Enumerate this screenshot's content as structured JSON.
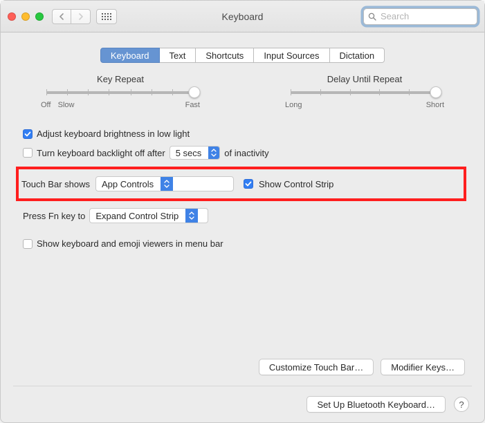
{
  "window": {
    "title": "Keyboard"
  },
  "search": {
    "placeholder": "Search"
  },
  "tabs": [
    {
      "label": "Keyboard",
      "active": true
    },
    {
      "label": "Text"
    },
    {
      "label": "Shortcuts"
    },
    {
      "label": "Input Sources"
    },
    {
      "label": "Dictation"
    }
  ],
  "sliders": {
    "key_repeat": {
      "title": "Key Repeat",
      "left": "Off",
      "left2": "Slow",
      "right": "Fast",
      "pos": 1.0
    },
    "delay_until": {
      "title": "Delay Until Repeat",
      "left": "Long",
      "right": "Short",
      "pos": 0.98
    }
  },
  "checks": {
    "brightness": {
      "label": "Adjust keyboard brightness in low light",
      "checked": true
    },
    "backlight_off": {
      "label": "Turn keyboard backlight off after",
      "checked": false
    },
    "backlight_time": "5 secs",
    "inactivity_suffix": "of inactivity",
    "touchbar_label": "Touch Bar shows",
    "touchbar_value": "App Controls",
    "show_control_strip": {
      "label": "Show Control Strip",
      "checked": true
    },
    "fn_label": "Press Fn key to",
    "fn_value": "Expand Control Strip",
    "show_viewers": {
      "label": "Show keyboard and emoji viewers in menu bar",
      "checked": false
    }
  },
  "buttons": {
    "customize_touchbar": "Customize Touch Bar…",
    "modifier_keys": "Modifier Keys…",
    "bluetooth_kb": "Set Up Bluetooth Keyboard…",
    "help": "?"
  }
}
